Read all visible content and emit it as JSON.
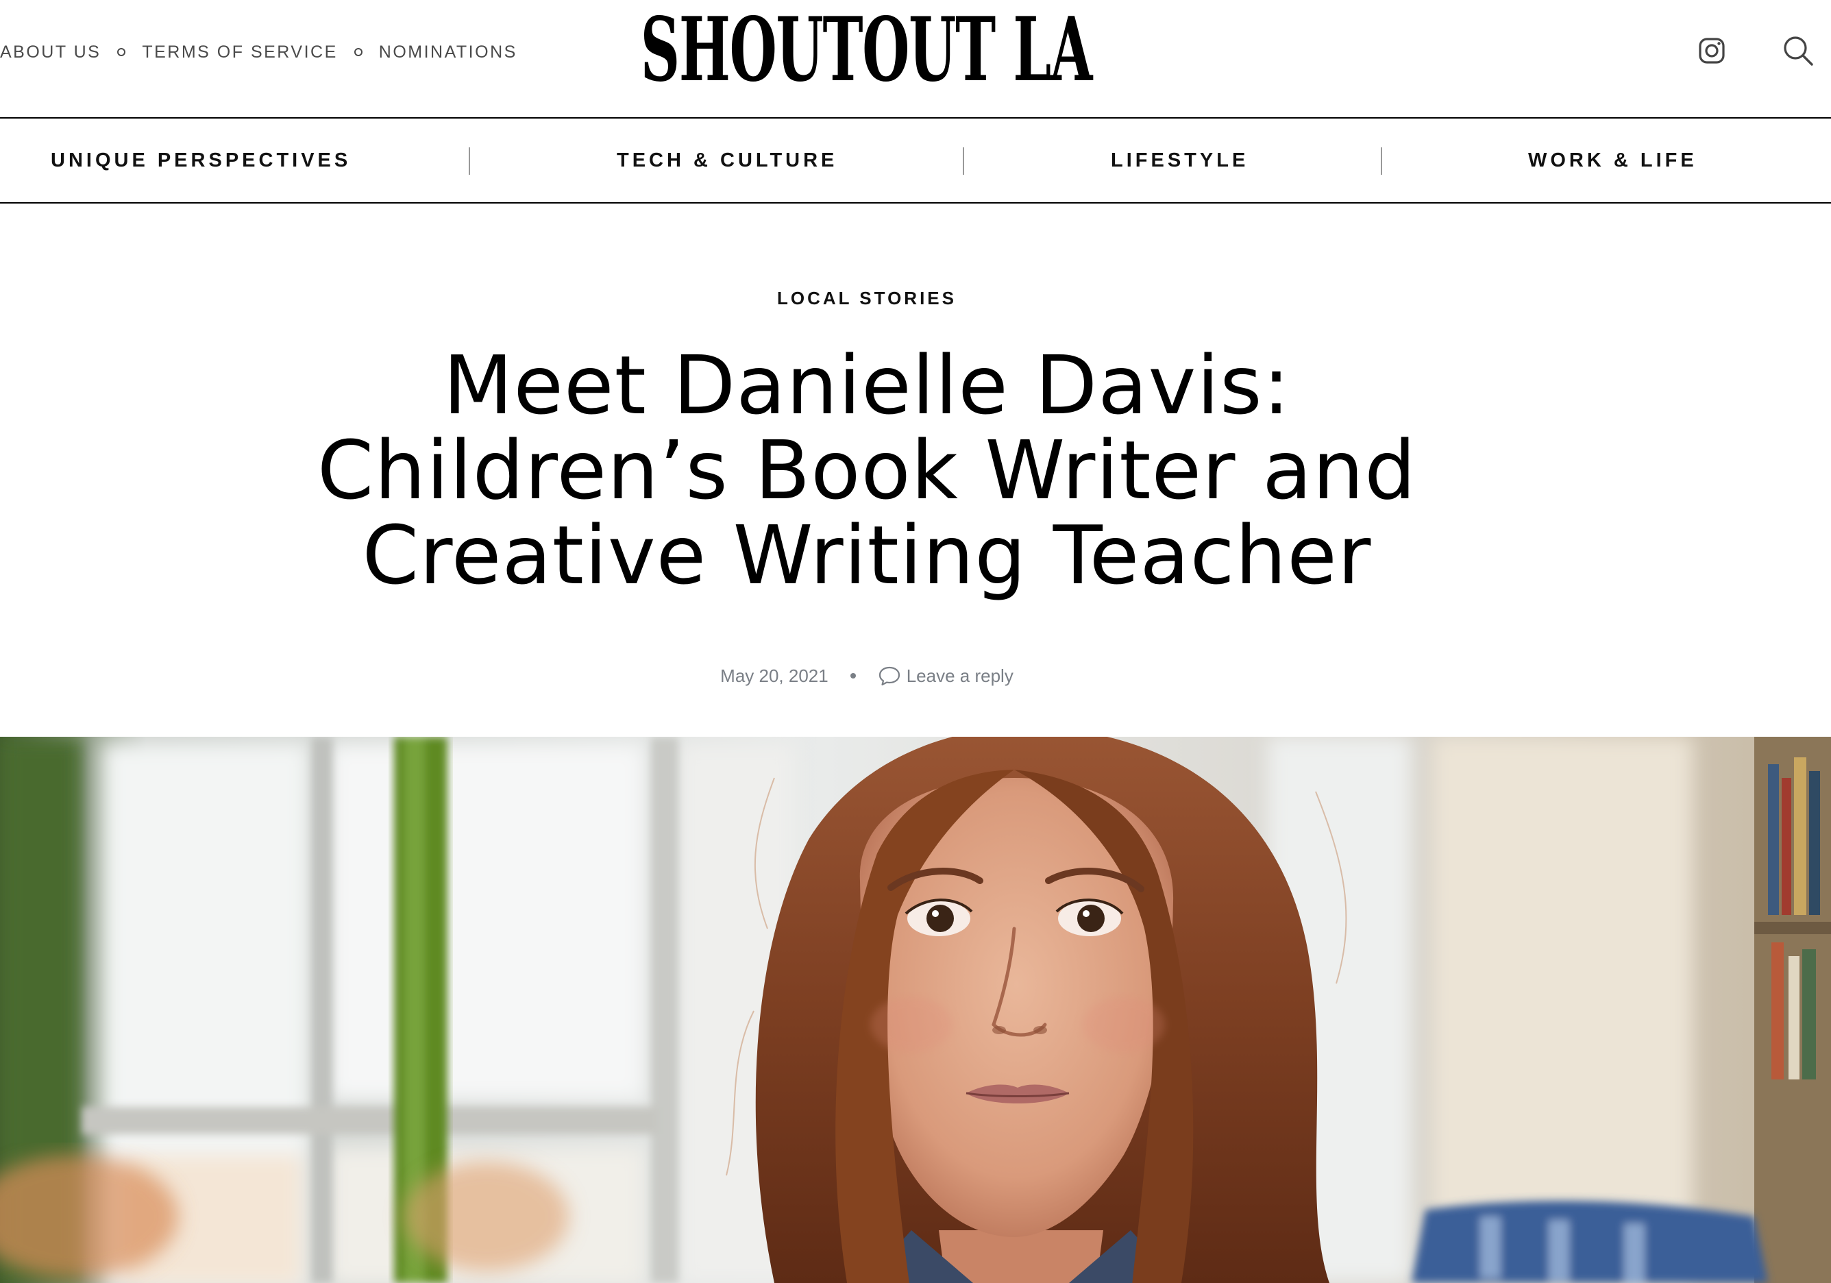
{
  "top_links": {
    "about": "ABOUT US",
    "terms": "TERMS OF SERVICE",
    "nominations": "NOMINATIONS"
  },
  "logo": "SHOUTOUT LA",
  "header_icons": [
    "instagram-icon",
    "search-icon"
  ],
  "nav": {
    "items": [
      {
        "label": "UNIQUE PERSPECTIVES"
      },
      {
        "label": "TECH & CULTURE"
      },
      {
        "label": "LIFESTYLE"
      },
      {
        "label": "WORK & LIFE"
      }
    ]
  },
  "article": {
    "category": "LOCAL STORIES",
    "title_lines": [
      "Meet Danielle Davis:",
      "Children’s Book Writer and",
      "Creative Writing Teacher"
    ],
    "date": "May 20, 2021",
    "reply_label": "Leave a reply",
    "hero_image": "portrait of woman with long auburn hair"
  },
  "colors": {
    "text": "#000000",
    "muted": "#7a7f86",
    "top_link": "#4a4a4a",
    "hair": "#8a4a2a",
    "green_window": "#4f7a22"
  }
}
